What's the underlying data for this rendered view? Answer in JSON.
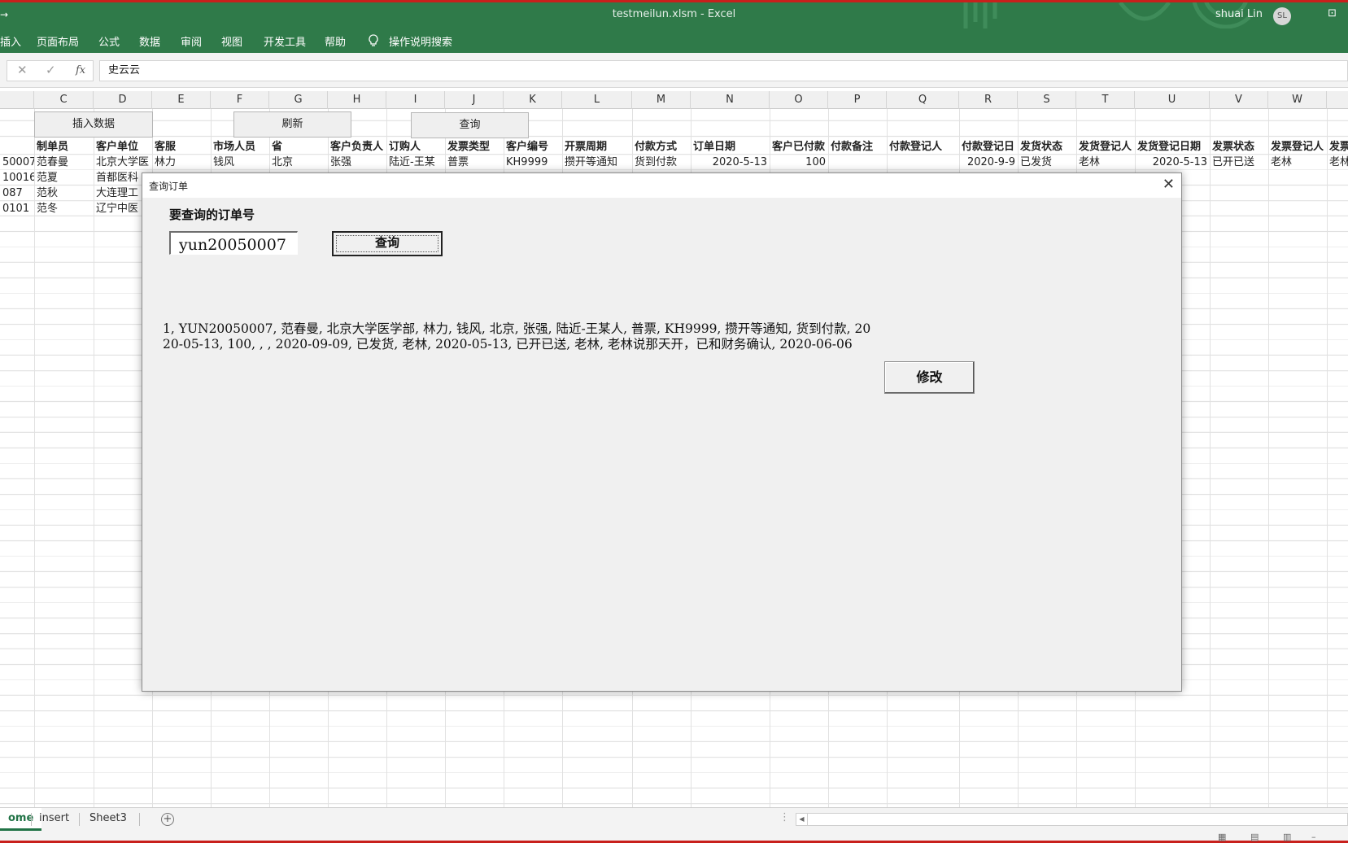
{
  "window": {
    "title": "testmeilun.xlsm  -  Excel",
    "user_name": "shuai Lin",
    "user_initials": "SL",
    "qa_glyph": "→"
  },
  "ribbon": {
    "tabs": [
      "插入",
      "页面布局",
      "公式",
      "数据",
      "审阅",
      "视图",
      "开发工具",
      "帮助"
    ],
    "tell_me": "操作说明搜索"
  },
  "formula_bar": {
    "value": "史云云"
  },
  "columns": [
    "C",
    "D",
    "E",
    "F",
    "G",
    "H",
    "I",
    "J",
    "K",
    "L",
    "M",
    "N",
    "O",
    "P",
    "Q",
    "R",
    "S",
    "T",
    "U",
    "V",
    "W"
  ],
  "sheet_buttons": {
    "insert": "插入数据",
    "refresh": "刷新",
    "query": "查询"
  },
  "table": {
    "headers": [
      "制单员",
      "客户单位",
      "客服",
      "市场人员",
      "省",
      "客户负责人",
      "订购人",
      "发票类型",
      "客户编号",
      "开票周期",
      "付款方式",
      "订单日期",
      "客户已付款",
      "付款备注",
      "付款登记人",
      "付款登记日",
      "发货状态",
      "发货登记人",
      "发货登记日期",
      "发票状态",
      "发票登记人",
      "发票"
    ],
    "rows": [
      {
        "id": "50007",
        "cells": [
          "范春曼",
          "北京大学医",
          "林力",
          "钱风",
          "北京",
          "张强",
          "陆近-王某",
          "普票",
          "KH9999",
          "攒开等通知",
          "货到付款",
          "2020-5-13",
          "100",
          "",
          "",
          "2020-9-9",
          "已发货",
          "老林",
          "2020-5-13",
          "已开已送",
          "老林",
          "老林"
        ]
      },
      {
        "id": "10016",
        "cells": [
          "范夏",
          "首都医科"
        ]
      },
      {
        "id": "087",
        "cells": [
          "范秋",
          "大连理工"
        ]
      },
      {
        "id": "0101",
        "cells": [
          "范冬",
          "辽宁中医"
        ]
      }
    ]
  },
  "sheet_tabs": [
    "ome",
    "insert",
    "Sheet3"
  ],
  "dialog": {
    "title": "查询订单",
    "label": "要查询的订单号",
    "order_input_value": "yun20050007",
    "query_button": "查询",
    "result_text": "1, YUN20050007, 范春曼, 北京大学医学部, 林力, 钱风, 北京, 张强, 陆近-王某人, 普票, KH9999, 攒开等通知, 货到付款, 2020-05-13, 100, , , 2020-09-09, 已发货, 老林, 2020-05-13, 已开已送, 老林, 老林说那天开，已和财务确认, 2020-06-06",
    "edit_button": "修改"
  },
  "colors": {
    "excel_green": "#2f7a49",
    "accent_red": "#c8201c",
    "dialog_bg": "#f0f0f0"
  }
}
